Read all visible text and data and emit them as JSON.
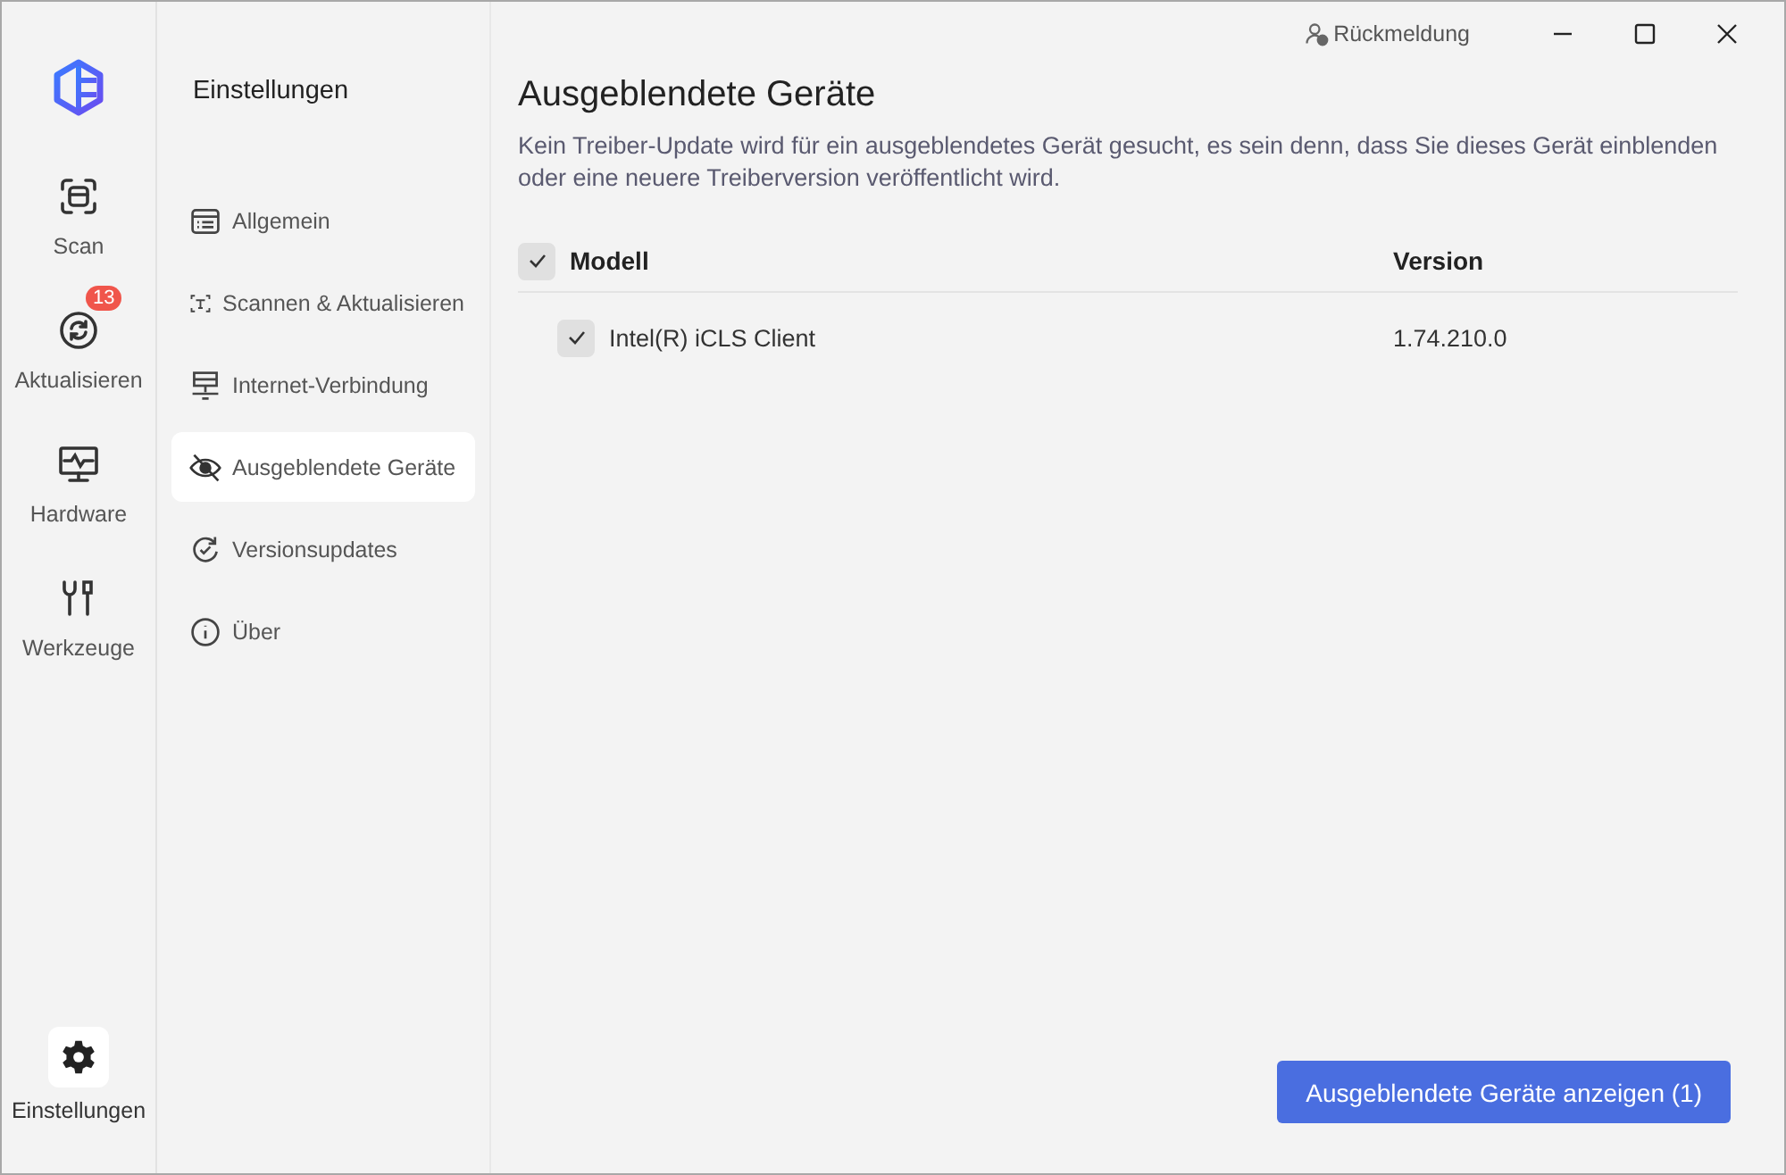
{
  "rail": {
    "items": [
      {
        "label": "Scan",
        "selected": false
      },
      {
        "label": "Aktualisieren",
        "selected": false,
        "badge": "13"
      },
      {
        "label": "Hardware",
        "selected": false
      },
      {
        "label": "Werkzeuge",
        "selected": false
      }
    ],
    "settings": {
      "label": "Einstellungen",
      "selected": true
    }
  },
  "settings_menu": {
    "title": "Einstellungen",
    "items": [
      {
        "label": "Allgemein",
        "selected": false
      },
      {
        "label": "Scannen & Aktualisieren",
        "selected": false
      },
      {
        "label": "Internet-Verbindung",
        "selected": false
      },
      {
        "label": "Ausgeblendete Geräte",
        "selected": true
      },
      {
        "label": "Versionsupdates",
        "selected": false
      },
      {
        "label": "Über",
        "selected": false
      }
    ]
  },
  "titlebar": {
    "feedback": "Rückmeldung"
  },
  "page": {
    "title": "Ausgeblendete Geräte",
    "description": "Kein Treiber-Update wird für ein ausgeblendetes Gerät gesucht, es sein denn, dass Sie dieses Gerät einblenden oder eine neuere Treiberversion veröffentlicht wird."
  },
  "table": {
    "select_all": {
      "checked": true
    },
    "columns": [
      "Modell",
      "Version"
    ],
    "rows": [
      {
        "model": "Intel(R) iCLS Client",
        "version": "1.74.210.0",
        "checked": true
      }
    ]
  },
  "action_button": "Ausgeblendete Geräte anzeigen (1)"
}
